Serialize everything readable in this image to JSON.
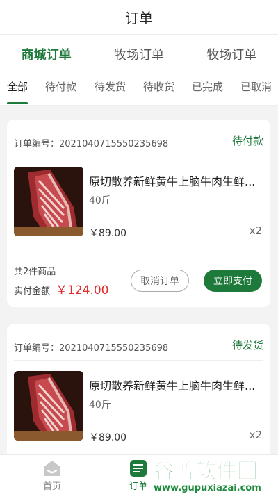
{
  "header": {
    "title": "订单"
  },
  "main_tabs": [
    {
      "label": "商城订单",
      "active": true
    },
    {
      "label": "牧场订单",
      "active": false
    },
    {
      "label": "牧场订单",
      "active": false
    }
  ],
  "sub_tabs": [
    {
      "label": "全部",
      "active": true
    },
    {
      "label": "待付款",
      "active": false
    },
    {
      "label": "待发货",
      "active": false
    },
    {
      "label": "待收货",
      "active": false
    },
    {
      "label": "已完成",
      "active": false
    },
    {
      "label": "已取消",
      "active": false
    }
  ],
  "orders": [
    {
      "order_no": "订单编号：2021040715550235698",
      "status": "待付款",
      "product_name": "原切散养新鲜黄牛上脑牛肉生鲜...",
      "spec": "40斤",
      "price": "￥89.00",
      "qty": "x2",
      "total_count": "共2件商品",
      "paid_label": "实付金额",
      "paid_amount": "￥124.00",
      "cancel_label": "取消订单",
      "pay_label": "立即支付"
    },
    {
      "order_no": "订单编号：2021040715550235698",
      "status": "待发货",
      "product_name": "原切散养新鲜黄牛上脑牛肉生鲜...",
      "spec": "40斤",
      "price": "￥89.00",
      "qty": "x2"
    }
  ],
  "bottom_nav": [
    {
      "label": "首页",
      "icon": "home-icon",
      "active": false
    },
    {
      "label": "订单",
      "icon": "order-list-icon",
      "active": true
    }
  ],
  "watermark": {
    "text": "谷普软件园",
    "url": "www.gupuxiazai.com"
  },
  "colors": {
    "accent": "#1e7a3a",
    "price_red": "#e02b2b",
    "background": "#f3f3f3"
  }
}
